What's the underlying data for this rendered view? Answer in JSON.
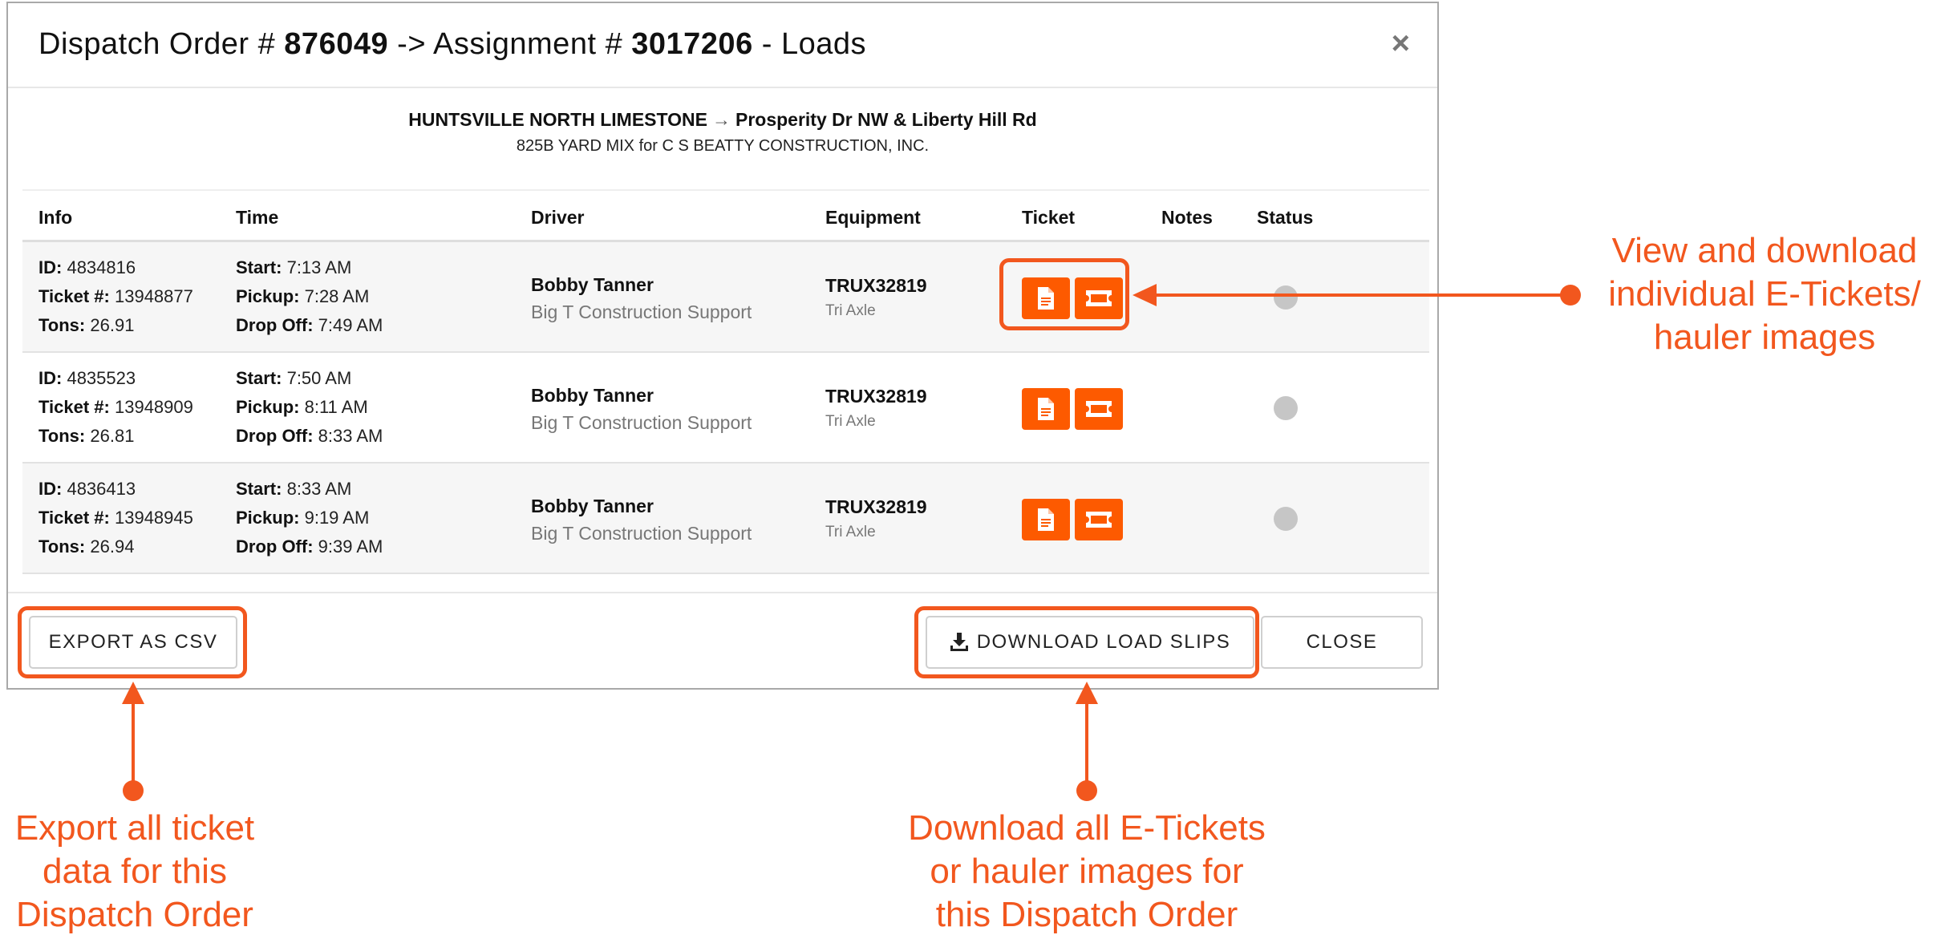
{
  "modal": {
    "title_prefix": "Dispatch Order # ",
    "dispatch_number": "876049",
    "title_mid": " -> Assignment # ",
    "assignment_number": "3017206",
    "title_suffix": " - Loads",
    "close_glyph": "×"
  },
  "route": {
    "origin": "HUNTSVILLE NORTH LIMESTONE",
    "arrow": "→",
    "destination": "Prosperity Dr NW & Liberty Hill Rd",
    "material": "825B YARD MIX for C S BEATTY CONSTRUCTION, INC."
  },
  "table": {
    "headers": [
      "Info",
      "Time",
      "Driver",
      "Equipment",
      "Ticket",
      "Notes",
      "Status"
    ],
    "labels": {
      "id": "ID:",
      "ticket": "Ticket #:",
      "tons": "Tons:",
      "start": "Start:",
      "pickup": "Pickup:",
      "dropoff": "Drop Off:"
    },
    "rows": [
      {
        "id": "4834816",
        "ticket": "13948877",
        "tons": "26.91",
        "start": "7:13 AM",
        "pickup": "7:28 AM",
        "dropoff": "7:49 AM",
        "driver": "Bobby Tanner",
        "company": "Big T Construction Support",
        "equipment": "TRUX32819",
        "equipment_type": "Tri Axle",
        "notes": "",
        "status": "inactive"
      },
      {
        "id": "4835523",
        "ticket": "13948909",
        "tons": "26.81",
        "start": "7:50 AM",
        "pickup": "8:11 AM",
        "dropoff": "8:33 AM",
        "driver": "Bobby Tanner",
        "company": "Big T Construction Support",
        "equipment": "TRUX32819",
        "equipment_type": "Tri Axle",
        "notes": "",
        "status": "inactive"
      },
      {
        "id": "4836413",
        "ticket": "13948945",
        "tons": "26.94",
        "start": "8:33 AM",
        "pickup": "9:19 AM",
        "dropoff": "9:39 AM",
        "driver": "Bobby Tanner",
        "company": "Big T Construction Support",
        "equipment": "TRUX32819",
        "equipment_type": "Tri Axle",
        "notes": "",
        "status": "inactive"
      }
    ],
    "ticket_icons": [
      "document-icon",
      "ticket-icon"
    ]
  },
  "footer": {
    "export_label": "EXPORT AS CSV",
    "download_label": "DOWNLOAD LOAD SLIPS",
    "download_icon": "download-icon",
    "close_label": "CLOSE"
  },
  "annotations": {
    "tickets": [
      "View and download",
      "individual E-Tickets/",
      "hauler images"
    ],
    "export": [
      "Export all ticket",
      "data for this",
      "Dispatch Order"
    ],
    "download": [
      "Download all E-Tickets",
      "or hauler images for",
      "this Dispatch Order"
    ]
  },
  "colors": {
    "accent": "#fd5a00",
    "annotation": "#f2571e",
    "status_inactive": "#c6c6c6"
  }
}
